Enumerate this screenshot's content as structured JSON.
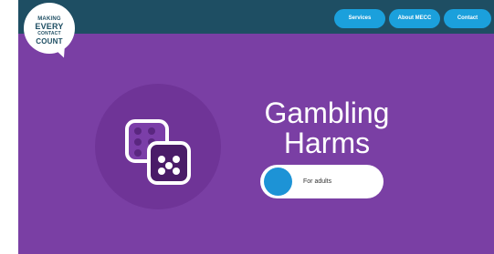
{
  "logo": {
    "line1": "MAKING",
    "line2": "EVERY",
    "line3": "CONTACT",
    "line4": "COUNT"
  },
  "nav": {
    "items": [
      {
        "label": "Services"
      },
      {
        "label": "About MECC"
      },
      {
        "label": "Contact"
      }
    ]
  },
  "hero": {
    "title_line1": "Gambling",
    "title_line2": "Harms",
    "icon": "dice-icon",
    "toggle": {
      "label": "For adults",
      "state": "off"
    }
  },
  "colors": {
    "topbar": "#1e4e63",
    "hero_background": "#7a3fa4",
    "nav_button": "#1ba0dc",
    "toggle_knob": "#1d93d6"
  }
}
